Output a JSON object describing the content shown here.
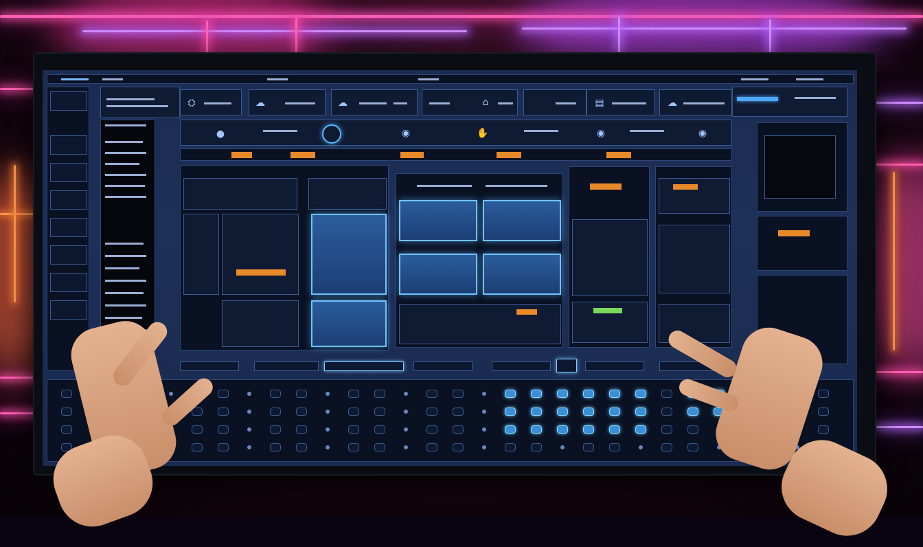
{
  "scene": {
    "description_free": true,
    "accent_colors": {
      "screen_blue": "#1d3058",
      "panel_glow": "#6fc3ff",
      "neon_pink": "#ff5fb4",
      "neon_violet": "#d08cff",
      "badge_orange": "#e88a2a",
      "skin": "#d9a07c"
    }
  },
  "screen": {
    "top_tabs": [
      "",
      "",
      "",
      "",
      "",
      ""
    ],
    "left_nav": [
      "",
      "",
      "",
      "",
      "",
      "",
      "",
      ""
    ],
    "toolbar_icons": [
      "network-icon",
      "cloud-icon",
      "cloud-icon",
      "cloud-icon",
      "home-icon",
      "document-icon",
      "cloud-icon"
    ],
    "knob_icons": [
      "knob-icon",
      "record-icon",
      "knob-icon",
      "hand-icon",
      "knob-icon",
      "knob-icon",
      "knob-icon",
      "knob-icon"
    ],
    "bottom_buttons": [
      "",
      "",
      "",
      "",
      "",
      "",
      "",
      ""
    ]
  }
}
